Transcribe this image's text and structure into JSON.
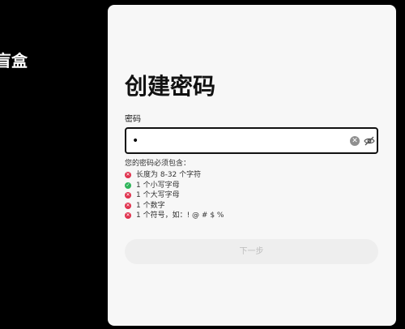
{
  "brand": {
    "name": "盲盒"
  },
  "signup": {
    "title": "创建密码",
    "password_label": "密码",
    "password_value": "•",
    "requirements_title": "您的密码必须包含：",
    "requirements": [
      {
        "text": "长度为 8-32 个字符",
        "status": "fail"
      },
      {
        "text": "1 个小写字母",
        "status": "pass"
      },
      {
        "text": "1 个大写字母",
        "status": "fail"
      },
      {
        "text": "1 个数字",
        "status": "fail"
      },
      {
        "text": "1 个符号，如：! @ # $ %",
        "status": "fail"
      }
    ],
    "next_label": "下一步"
  },
  "icons": {
    "clear": "clear-icon",
    "toggle_visibility": "eye-slash-icon",
    "requirement_fail": "x-circle-icon",
    "requirement_pass": "check-circle-icon"
  },
  "colors": {
    "background": "#000000",
    "card": "#f7f7f7",
    "fail": "#e0334f",
    "pass": "#2fb45a",
    "button_disabled": "#eeeeee"
  }
}
